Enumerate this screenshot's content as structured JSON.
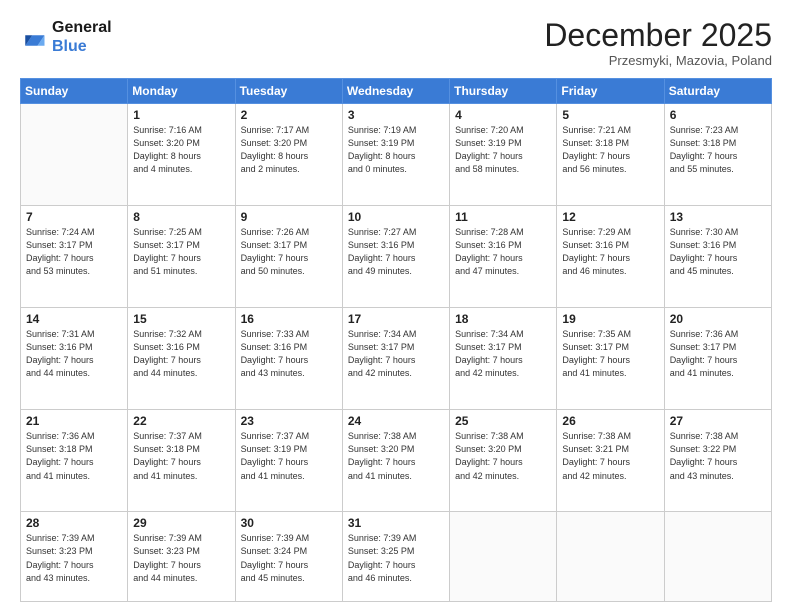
{
  "logo": {
    "line1": "General",
    "line2": "Blue"
  },
  "header": {
    "month": "December 2025",
    "location": "Przesmyki, Mazovia, Poland"
  },
  "weekdays": [
    "Sunday",
    "Monday",
    "Tuesday",
    "Wednesday",
    "Thursday",
    "Friday",
    "Saturday"
  ],
  "weeks": [
    [
      {
        "day": "",
        "info": ""
      },
      {
        "day": "1",
        "info": "Sunrise: 7:16 AM\nSunset: 3:20 PM\nDaylight: 8 hours\nand 4 minutes."
      },
      {
        "day": "2",
        "info": "Sunrise: 7:17 AM\nSunset: 3:20 PM\nDaylight: 8 hours\nand 2 minutes."
      },
      {
        "day": "3",
        "info": "Sunrise: 7:19 AM\nSunset: 3:19 PM\nDaylight: 8 hours\nand 0 minutes."
      },
      {
        "day": "4",
        "info": "Sunrise: 7:20 AM\nSunset: 3:19 PM\nDaylight: 7 hours\nand 58 minutes."
      },
      {
        "day": "5",
        "info": "Sunrise: 7:21 AM\nSunset: 3:18 PM\nDaylight: 7 hours\nand 56 minutes."
      },
      {
        "day": "6",
        "info": "Sunrise: 7:23 AM\nSunset: 3:18 PM\nDaylight: 7 hours\nand 55 minutes."
      }
    ],
    [
      {
        "day": "7",
        "info": "Sunrise: 7:24 AM\nSunset: 3:17 PM\nDaylight: 7 hours\nand 53 minutes."
      },
      {
        "day": "8",
        "info": "Sunrise: 7:25 AM\nSunset: 3:17 PM\nDaylight: 7 hours\nand 51 minutes."
      },
      {
        "day": "9",
        "info": "Sunrise: 7:26 AM\nSunset: 3:17 PM\nDaylight: 7 hours\nand 50 minutes."
      },
      {
        "day": "10",
        "info": "Sunrise: 7:27 AM\nSunset: 3:16 PM\nDaylight: 7 hours\nand 49 minutes."
      },
      {
        "day": "11",
        "info": "Sunrise: 7:28 AM\nSunset: 3:16 PM\nDaylight: 7 hours\nand 47 minutes."
      },
      {
        "day": "12",
        "info": "Sunrise: 7:29 AM\nSunset: 3:16 PM\nDaylight: 7 hours\nand 46 minutes."
      },
      {
        "day": "13",
        "info": "Sunrise: 7:30 AM\nSunset: 3:16 PM\nDaylight: 7 hours\nand 45 minutes."
      }
    ],
    [
      {
        "day": "14",
        "info": "Sunrise: 7:31 AM\nSunset: 3:16 PM\nDaylight: 7 hours\nand 44 minutes."
      },
      {
        "day": "15",
        "info": "Sunrise: 7:32 AM\nSunset: 3:16 PM\nDaylight: 7 hours\nand 44 minutes."
      },
      {
        "day": "16",
        "info": "Sunrise: 7:33 AM\nSunset: 3:16 PM\nDaylight: 7 hours\nand 43 minutes."
      },
      {
        "day": "17",
        "info": "Sunrise: 7:34 AM\nSunset: 3:17 PM\nDaylight: 7 hours\nand 42 minutes."
      },
      {
        "day": "18",
        "info": "Sunrise: 7:34 AM\nSunset: 3:17 PM\nDaylight: 7 hours\nand 42 minutes."
      },
      {
        "day": "19",
        "info": "Sunrise: 7:35 AM\nSunset: 3:17 PM\nDaylight: 7 hours\nand 41 minutes."
      },
      {
        "day": "20",
        "info": "Sunrise: 7:36 AM\nSunset: 3:17 PM\nDaylight: 7 hours\nand 41 minutes."
      }
    ],
    [
      {
        "day": "21",
        "info": "Sunrise: 7:36 AM\nSunset: 3:18 PM\nDaylight: 7 hours\nand 41 minutes."
      },
      {
        "day": "22",
        "info": "Sunrise: 7:37 AM\nSunset: 3:18 PM\nDaylight: 7 hours\nand 41 minutes."
      },
      {
        "day": "23",
        "info": "Sunrise: 7:37 AM\nSunset: 3:19 PM\nDaylight: 7 hours\nand 41 minutes."
      },
      {
        "day": "24",
        "info": "Sunrise: 7:38 AM\nSunset: 3:20 PM\nDaylight: 7 hours\nand 41 minutes."
      },
      {
        "day": "25",
        "info": "Sunrise: 7:38 AM\nSunset: 3:20 PM\nDaylight: 7 hours\nand 42 minutes."
      },
      {
        "day": "26",
        "info": "Sunrise: 7:38 AM\nSunset: 3:21 PM\nDaylight: 7 hours\nand 42 minutes."
      },
      {
        "day": "27",
        "info": "Sunrise: 7:38 AM\nSunset: 3:22 PM\nDaylight: 7 hours\nand 43 minutes."
      }
    ],
    [
      {
        "day": "28",
        "info": "Sunrise: 7:39 AM\nSunset: 3:23 PM\nDaylight: 7 hours\nand 43 minutes."
      },
      {
        "day": "29",
        "info": "Sunrise: 7:39 AM\nSunset: 3:23 PM\nDaylight: 7 hours\nand 44 minutes."
      },
      {
        "day": "30",
        "info": "Sunrise: 7:39 AM\nSunset: 3:24 PM\nDaylight: 7 hours\nand 45 minutes."
      },
      {
        "day": "31",
        "info": "Sunrise: 7:39 AM\nSunset: 3:25 PM\nDaylight: 7 hours\nand 46 minutes."
      },
      {
        "day": "",
        "info": ""
      },
      {
        "day": "",
        "info": ""
      },
      {
        "day": "",
        "info": ""
      }
    ]
  ]
}
